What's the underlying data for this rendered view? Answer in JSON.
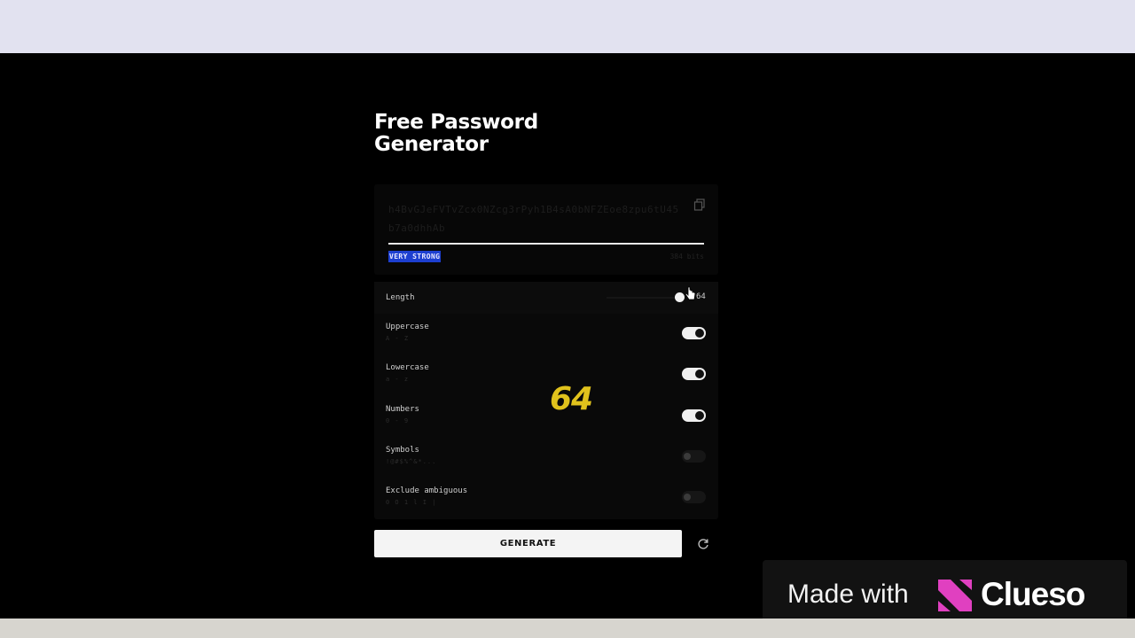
{
  "page": {
    "title_line1": "Free Password",
    "title_line2": "Generator"
  },
  "password": {
    "value": "h4BvGJeFVTvZcx0NZcg3rPyh1B4sA0bNFZEoe8zpu6tU45b7a0dhhAb",
    "strength_label": "VERY STRONG",
    "bits_label": "384 bits"
  },
  "options": {
    "length": {
      "label": "Length",
      "value": "64",
      "slider_fraction": 0.85
    },
    "items": [
      {
        "label": "Uppercase",
        "sub": "A - Z",
        "state": "on"
      },
      {
        "label": "Lowercase",
        "sub": "a - z",
        "state": "on"
      },
      {
        "label": "Numbers",
        "sub": "0 - 9",
        "state": "on"
      },
      {
        "label": "Symbols",
        "sub": "!@#$%^&*...",
        "state": "off"
      },
      {
        "label": "Exclude ambiguous",
        "sub": "0 O 1 l I |",
        "state": "off"
      }
    ]
  },
  "overlay": {
    "value": "64"
  },
  "actions": {
    "generate_label": "GENERATE"
  },
  "watermark": {
    "made_with": "Made with",
    "brand": "Clueso"
  },
  "colors": {
    "strength_badge": "#1d3fd0",
    "overlay_number": "#e0c21c",
    "brand_logo": "#e040c0"
  }
}
